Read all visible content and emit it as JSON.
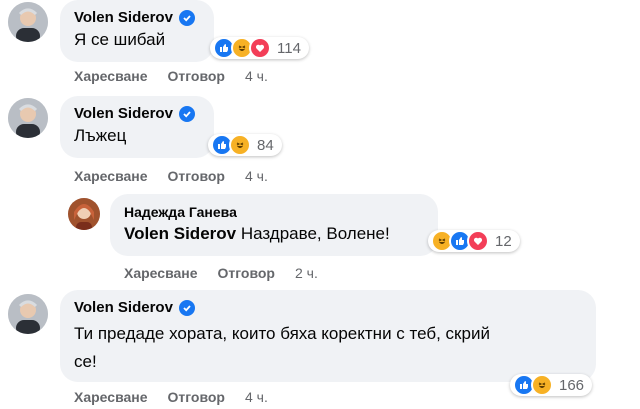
{
  "comments": [
    {
      "author": "Volen Siderov",
      "text": "Я се шибай",
      "reaction_count": "114",
      "like_label": "Харесване",
      "reply_label": "Отговор",
      "time": "4 ч."
    },
    {
      "author": "Volen Siderov",
      "text": "Лъжец",
      "reaction_count": "84",
      "like_label": "Харесване",
      "reply_label": "Отговор",
      "time": "4 ч."
    },
    {
      "author": "Надежда Ганева",
      "mention": "Volen Siderov",
      "text": "Наздраве, Волене!",
      "reaction_count": "12",
      "like_label": "Харесване",
      "reply_label": "Отговор",
      "time": "2 ч."
    },
    {
      "author": "Volen Siderov",
      "text_line1": "Ти предаде хората, които бяха коректни с теб, скрий",
      "text_line2": "се!",
      "reaction_count": "166",
      "like_label": "Харесване",
      "reply_label": "Отговор",
      "time": "4 ч."
    }
  ],
  "colors": {
    "bubble": "#f0f2f5",
    "secondary_text": "#65676b",
    "like_blue": "#1877f2",
    "haha_yellow": "#f7b125",
    "love_red": "#f33e58"
  },
  "icons": [
    "verified-badge-icon",
    "like-reaction-icon",
    "haha-reaction-icon",
    "love-reaction-icon"
  ]
}
